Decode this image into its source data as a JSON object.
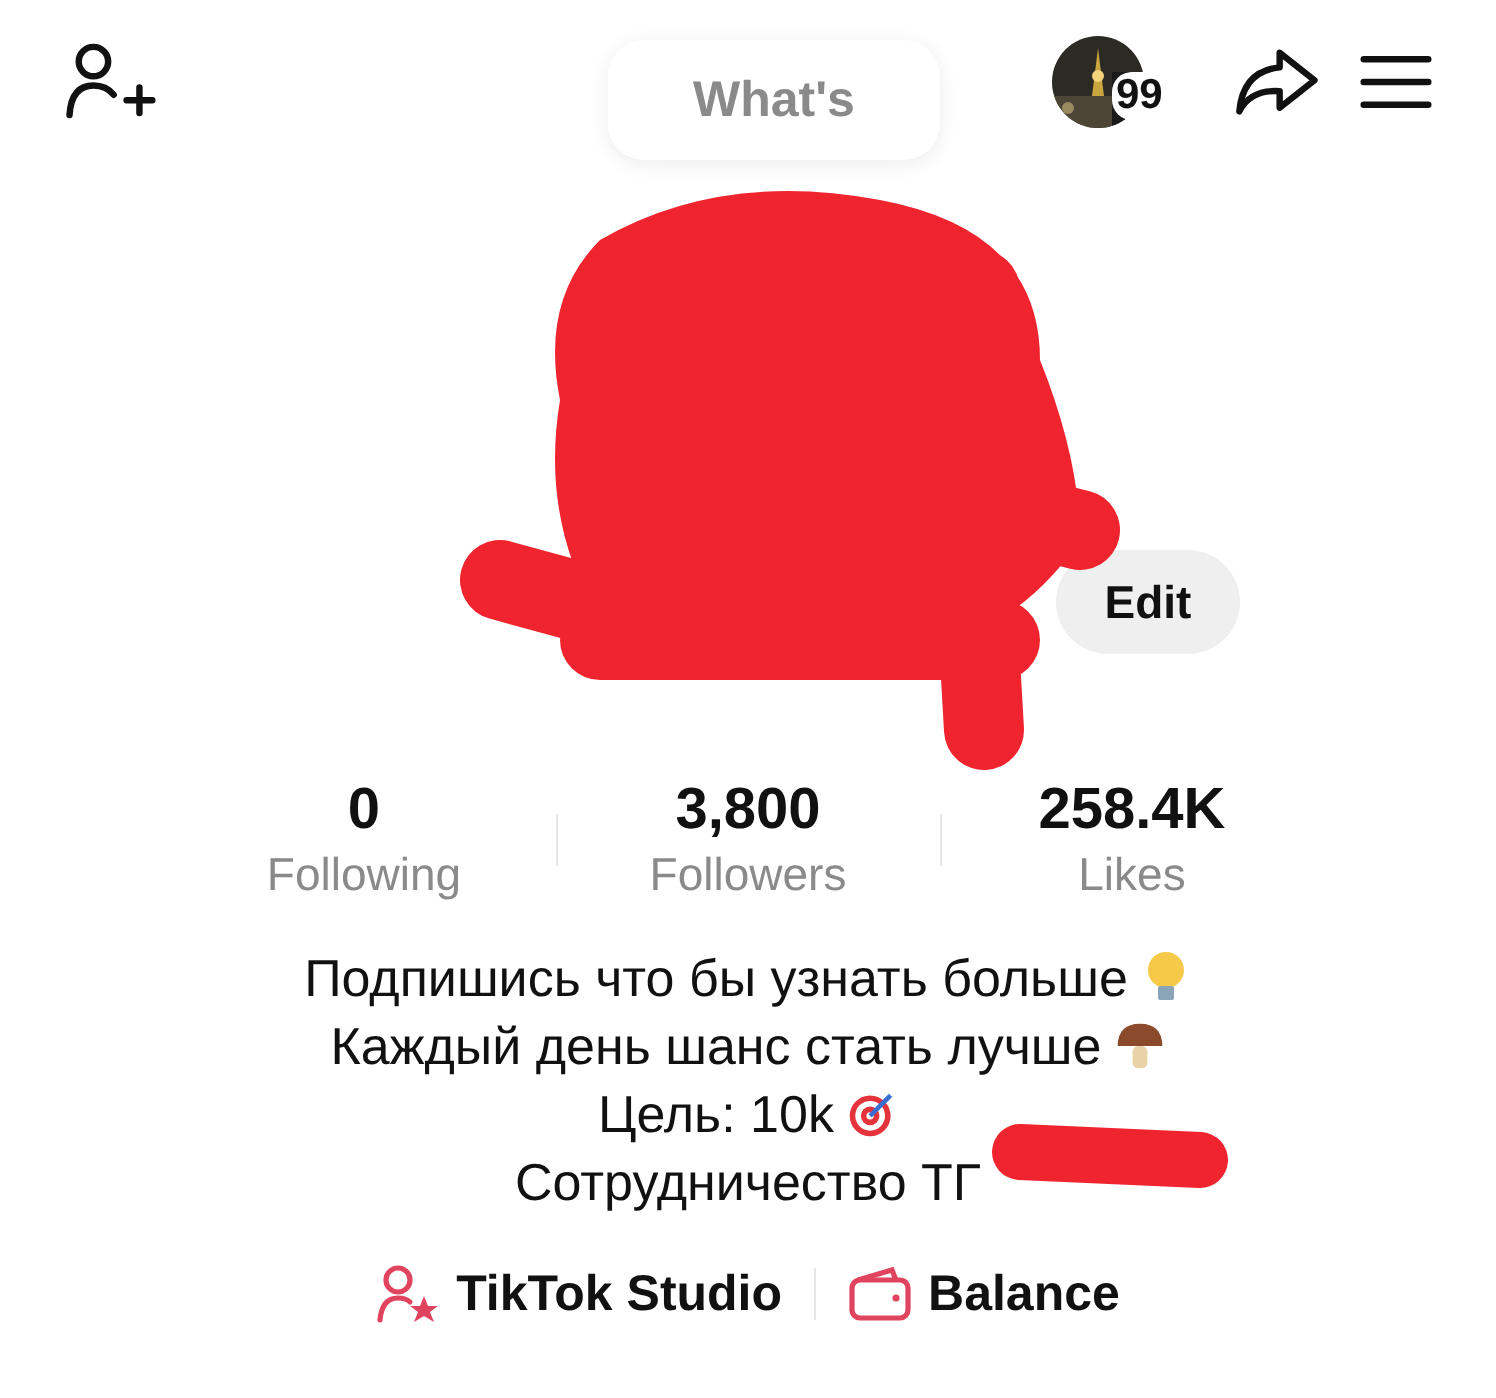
{
  "top_bar": {
    "note": "What's",
    "story_count": "99"
  },
  "edit_button": "Edit",
  "stats": [
    {
      "value": "0",
      "label": "Following"
    },
    {
      "value": "3,800",
      "label": "Followers"
    },
    {
      "value": "258.4K",
      "label": "Likes"
    }
  ],
  "bio": [
    {
      "text": "Подпишись что бы узнать больше",
      "kind": "bulb"
    },
    {
      "text": "Каждый день шанс стать лучше",
      "kind": "mushroom"
    },
    {
      "text": "Цель: 10k",
      "kind": "target"
    },
    {
      "text": "Сотрудничество ТГ",
      "kind": "plain"
    }
  ],
  "links": [
    {
      "kind": "studio",
      "label": "TikTok Studio"
    },
    {
      "kind": "balance",
      "label": "Balance"
    }
  ]
}
